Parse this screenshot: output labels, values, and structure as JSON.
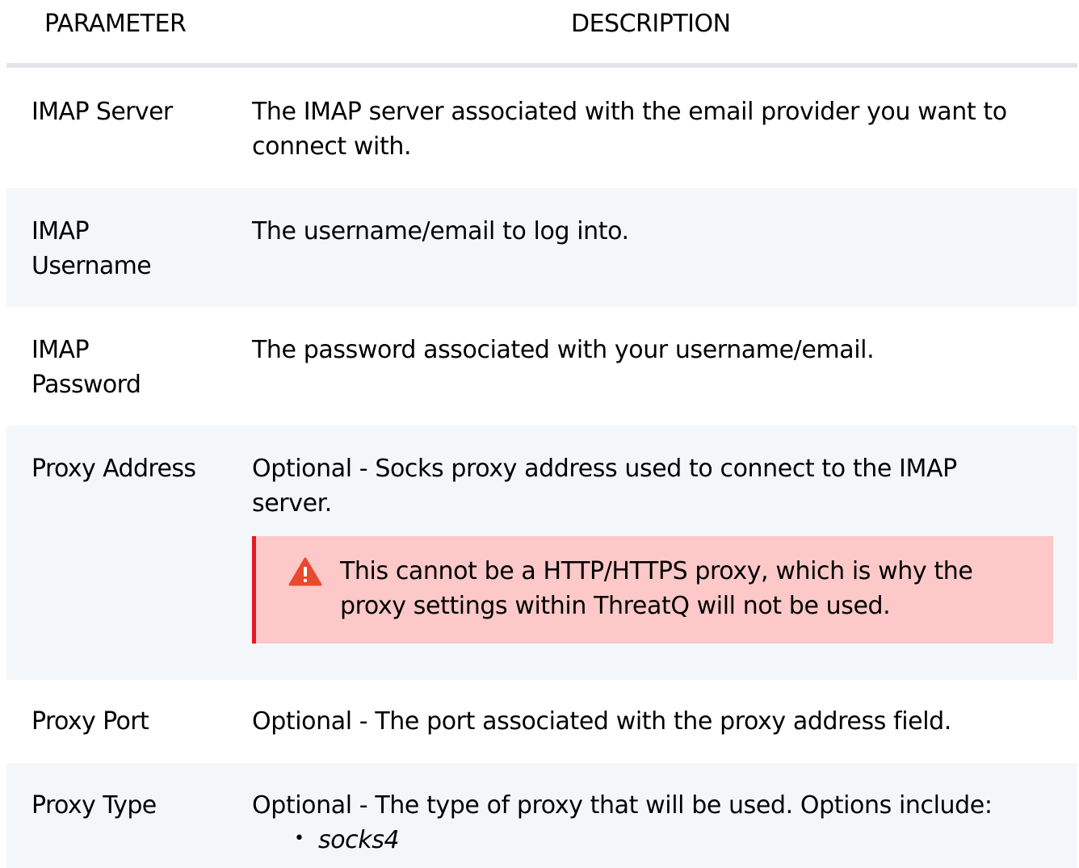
{
  "header": {
    "param_label": "PARAMETER",
    "desc_label": "DESCRIPTION"
  },
  "rows": [
    {
      "param": "IMAP Server",
      "desc": "The IMAP server associated with the email provider you want to connect with."
    },
    {
      "param": "IMAP Username",
      "desc": "The username/email to log into."
    },
    {
      "param": "IMAP Password",
      "desc": "The password associated with your username/email."
    },
    {
      "param": "Proxy Address",
      "desc": "Optional - Socks proxy address used to connect to the IMAP server.",
      "callout": {
        "icon": "warning-triangle-icon",
        "text": "This cannot be a HTTP/HTTPS proxy, which is why the proxy settings within ThreatQ will not be used."
      }
    },
    {
      "param": "Proxy Port",
      "desc": "Optional - The port associated with the proxy address field."
    },
    {
      "param": "Proxy Type",
      "desc": "Optional - The type of proxy that will be used. Options include:",
      "options": [
        "socks4"
      ]
    }
  ],
  "colors": {
    "header_rule": "#e2e6ec",
    "alt_row_bg": "#f4f7fa",
    "callout_bg": "#fcc8c8",
    "callout_border": "#e8191f",
    "warning_icon": "#e84a2d"
  }
}
